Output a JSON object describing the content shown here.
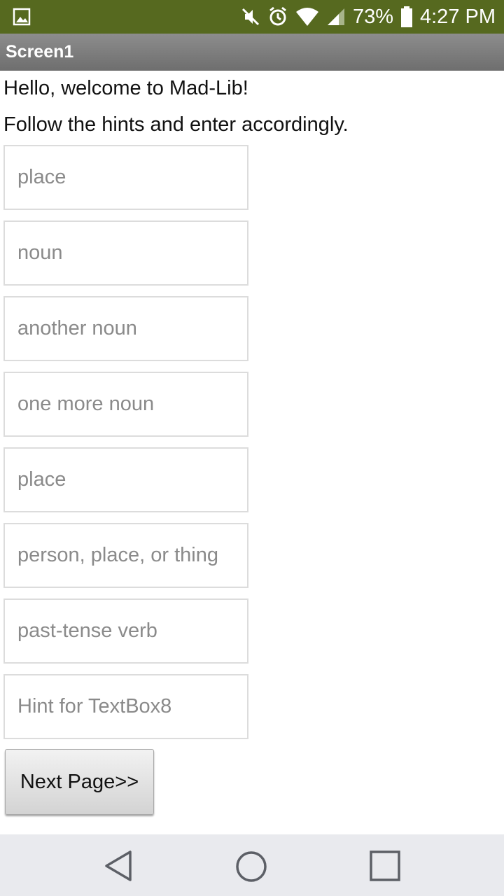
{
  "status_bar": {
    "battery_percent": "73%",
    "time": "4:27 PM",
    "background_color": "#56691f",
    "icons": [
      "gallery-icon",
      "mute-icon",
      "alarm-icon",
      "wifi-icon",
      "signal-icon",
      "battery-icon"
    ]
  },
  "title_bar": {
    "title": "Screen1"
  },
  "content": {
    "welcome_label": "Hello, welcome to Mad-Lib!",
    "instructions_label": "Follow the hints and enter accordingly.",
    "textboxes": [
      {
        "value": "",
        "placeholder": "place"
      },
      {
        "value": "",
        "placeholder": "noun"
      },
      {
        "value": "",
        "placeholder": "another noun"
      },
      {
        "value": "",
        "placeholder": "one more noun"
      },
      {
        "value": "",
        "placeholder": "place"
      },
      {
        "value": "",
        "placeholder": "person, place, or thing"
      },
      {
        "value": "",
        "placeholder": "past-tense verb"
      },
      {
        "value": "",
        "placeholder": "Hint for TextBox8"
      }
    ],
    "next_button_label": "Next Page>>"
  },
  "nav_bar": {
    "icons": [
      "back-icon",
      "home-icon",
      "recents-icon"
    ]
  }
}
